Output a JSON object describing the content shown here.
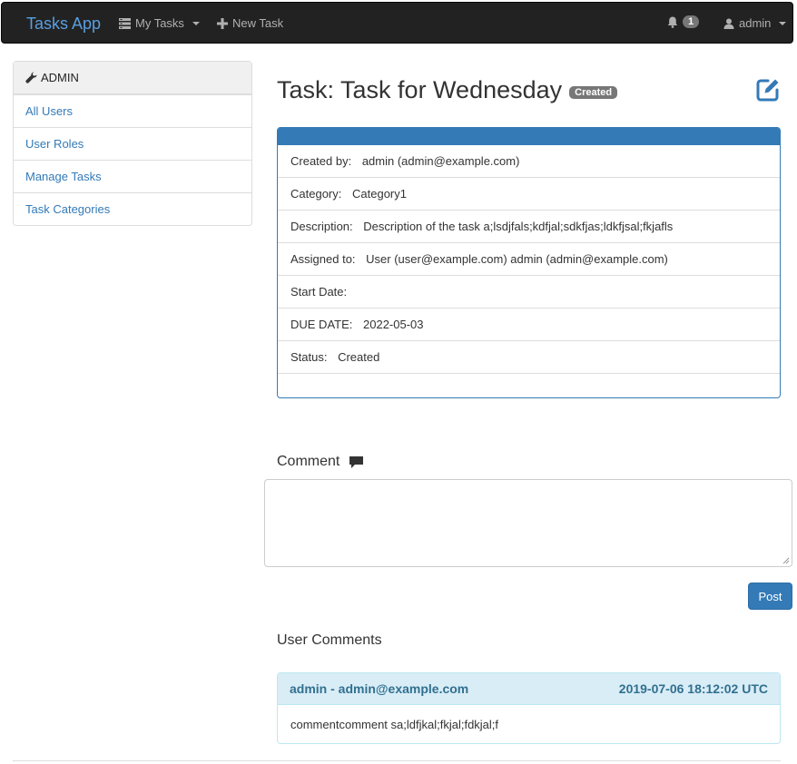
{
  "navbar": {
    "brand": "Tasks App",
    "my_tasks": "My Tasks",
    "new_task": "New Task",
    "notification_count": "1",
    "user": "admin"
  },
  "sidebar": {
    "header": "ADMIN",
    "items": [
      {
        "label": "All Users"
      },
      {
        "label": "User Roles"
      },
      {
        "label": "Manage Tasks"
      },
      {
        "label": "Task Categories"
      }
    ]
  },
  "task": {
    "title": "Task: Task for Wednesday",
    "status_badge": "Created",
    "details": {
      "created_by_label": "Created by:",
      "created_by": "admin (admin@example.com)",
      "category_label": "Category:",
      "category": "Category1",
      "description_label": "Description:",
      "description": "Description of the task a;lsdjfals;kdfjal;sdkfjas;ldkfjsal;fkjafls",
      "assigned_label": "Assigned to:",
      "assigned": "User (user@example.com) admin (admin@example.com)",
      "start_label": "Start Date:",
      "start": "",
      "due_label": "DUE DATE:",
      "due": "2022-05-03",
      "status_label": "Status:",
      "status": "Created"
    }
  },
  "comment_form": {
    "heading": "Comment",
    "value": "",
    "post_label": "Post"
  },
  "user_comments": {
    "heading": "User Comments",
    "items": [
      {
        "author": "admin - admin@example.com",
        "timestamp": "2019-07-06 18:12:02 UTC",
        "text": "commentcomment sa;ldfjkal;fkjal;fdkjal;f"
      }
    ]
  },
  "colors": {
    "primary": "#337ab7",
    "navbar_bg": "#222222",
    "badge": "#777777",
    "comment_head_bg": "#d9edf7"
  }
}
